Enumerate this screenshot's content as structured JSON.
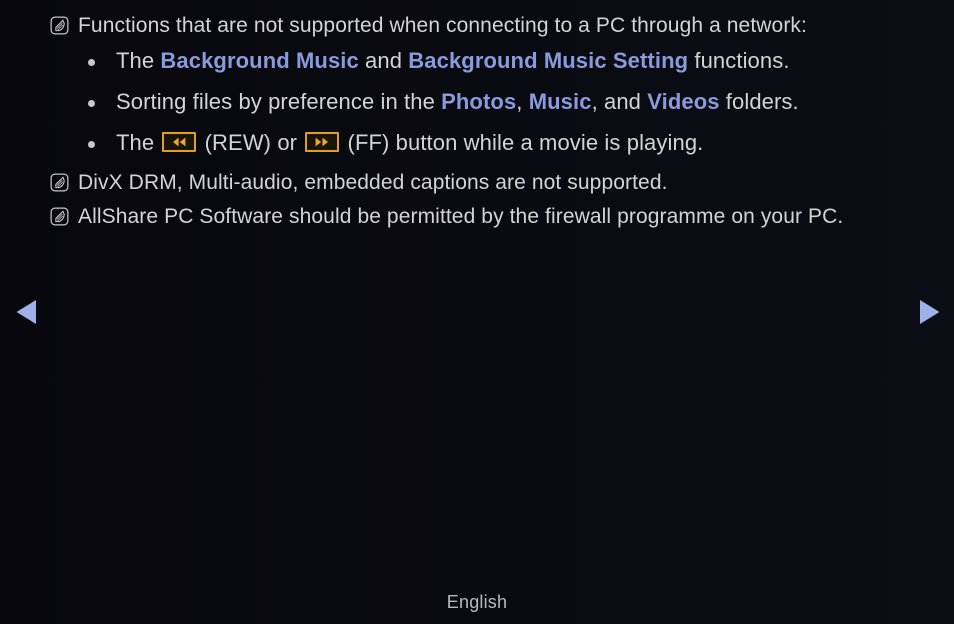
{
  "screen": {
    "background_color": "#08080e",
    "text_color": "#d4d4d6",
    "accent_color": "#8a9bdd",
    "key_color": "#e0a01d"
  },
  "notes": [
    {
      "icon": "note-pen-icon",
      "text": "Functions that are not supported when connecting to a PC through a network:"
    },
    {
      "icon": "note-pen-icon",
      "text": "DivX DRM, Multi-audio, embedded captions are not supported."
    },
    {
      "icon": "note-pen-icon",
      "text": "AllShare PC Software should be permitted by the firewall programme on your PC."
    }
  ],
  "bullets": [
    {
      "segments": [
        {
          "text": "The ",
          "style": "plain"
        },
        {
          "text": "Background Music",
          "style": "highlight"
        },
        {
          "text": " and ",
          "style": "plain"
        },
        {
          "text": "Background Music Setting",
          "style": "highlight"
        },
        {
          "text": " functions.",
          "style": "plain"
        }
      ]
    },
    {
      "segments": [
        {
          "text": "Sorting files by preference in the ",
          "style": "plain"
        },
        {
          "text": "Photos",
          "style": "highlight"
        },
        {
          "text": ", ",
          "style": "plain"
        },
        {
          "text": "Music",
          "style": "highlight"
        },
        {
          "text": ", and ",
          "style": "plain"
        },
        {
          "text": "Videos",
          "style": "highlight"
        },
        {
          "text": " folders.",
          "style": "plain"
        }
      ]
    },
    {
      "segments": [
        {
          "text": "The ",
          "style": "plain"
        },
        {
          "text": "rewind-key-icon",
          "style": "key-rew"
        },
        {
          "text": " (REW) or ",
          "style": "plain"
        },
        {
          "text": "fast-forward-key-icon",
          "style": "key-ff"
        },
        {
          "text": " (FF) button while a movie is playing.",
          "style": "plain"
        }
      ]
    }
  ],
  "navigation": {
    "prev_label": "previous-page-arrow",
    "next_label": "next-page-arrow"
  },
  "footer": {
    "language": "English"
  }
}
